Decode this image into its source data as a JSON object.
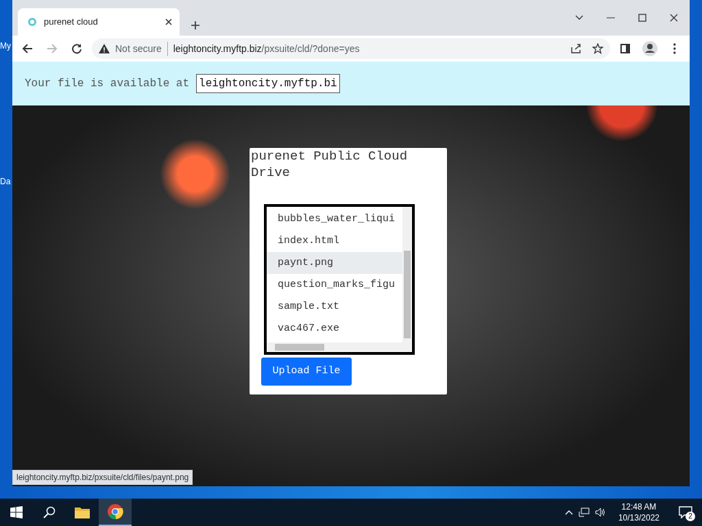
{
  "desktop": {
    "icon_labels": [
      "My",
      "Da"
    ]
  },
  "browser": {
    "tab": {
      "title": "purenet cloud"
    },
    "address": {
      "security": "Not secure",
      "host": "leightoncity.myftp.biz",
      "path": "/pxsuite/cld/?done=yes"
    }
  },
  "banner": {
    "text": "Your file is available at",
    "field_value": "leightoncity.myftp.bi"
  },
  "card": {
    "title": "purenet Public Cloud Drive",
    "files": [
      {
        "name": "bubbles_water_liqui",
        "selected": false
      },
      {
        "name": "index.html",
        "selected": false
      },
      {
        "name": "paynt.png",
        "selected": true
      },
      {
        "name": "question_marks_figu",
        "selected": false
      },
      {
        "name": "sample.txt",
        "selected": false
      },
      {
        "name": "vac467.exe",
        "selected": false
      }
    ],
    "button": "Upload File"
  },
  "status_url": "leightoncity.myftp.biz/pxsuite/cld/files/paynt.png",
  "taskbar": {
    "time": "12:48 AM",
    "date": "10/13/2022",
    "notification_count": "2"
  }
}
